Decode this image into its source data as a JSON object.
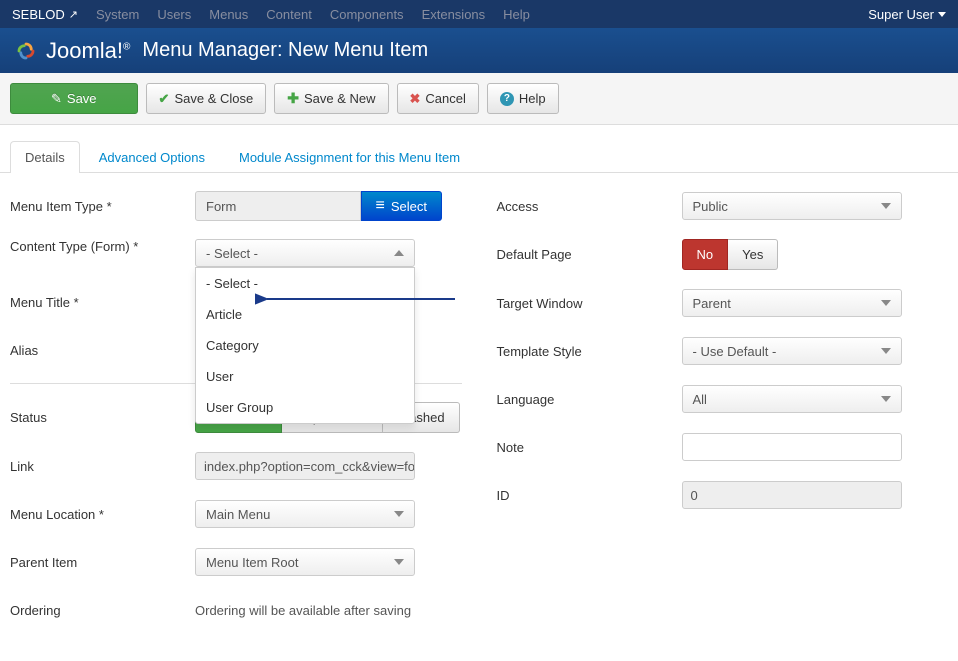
{
  "topbar": {
    "brand": "SEBLOD",
    "menu": [
      "System",
      "Users",
      "Menus",
      "Content",
      "Components",
      "Extensions",
      "Help"
    ],
    "user": "Super User"
  },
  "header": {
    "logo_text": "Joomla!",
    "title": "Menu Manager: New Menu Item"
  },
  "toolbar": {
    "save": "Save",
    "save_close": "Save & Close",
    "save_new": "Save & New",
    "cancel": "Cancel",
    "help": "Help"
  },
  "tabs": {
    "details": "Details",
    "advanced": "Advanced Options",
    "module": "Module Assignment for this Menu Item"
  },
  "left": {
    "menu_item_type_label": "Menu Item Type *",
    "menu_item_type_value": "Form",
    "select_btn": "Select",
    "content_type_label": "Content Type (Form) *",
    "content_type_value": "- Select -",
    "content_type_options": [
      "- Select -",
      "Article",
      "Category",
      "User",
      "User Group"
    ],
    "menu_title_label": "Menu Title *",
    "alias_label": "Alias",
    "status_label": "Status",
    "status_options": {
      "published": "Published",
      "unpublished": "Unpublished",
      "trashed": "Trashed"
    },
    "link_label": "Link",
    "link_value": "index.php?option=com_cck&view=fo",
    "menu_location_label": "Menu Location *",
    "menu_location_value": "Main Menu",
    "parent_item_label": "Parent Item",
    "parent_item_value": "Menu Item Root",
    "ordering_label": "Ordering",
    "ordering_note": "Ordering will be available after saving"
  },
  "right": {
    "access_label": "Access",
    "access_value": "Public",
    "default_page_label": "Default Page",
    "default_page_no": "No",
    "default_page_yes": "Yes",
    "target_window_label": "Target Window",
    "target_window_value": "Parent",
    "template_style_label": "Template Style",
    "template_style_value": "- Use Default -",
    "language_label": "Language",
    "language_value": "All",
    "note_label": "Note",
    "id_label": "ID",
    "id_value": "0"
  }
}
